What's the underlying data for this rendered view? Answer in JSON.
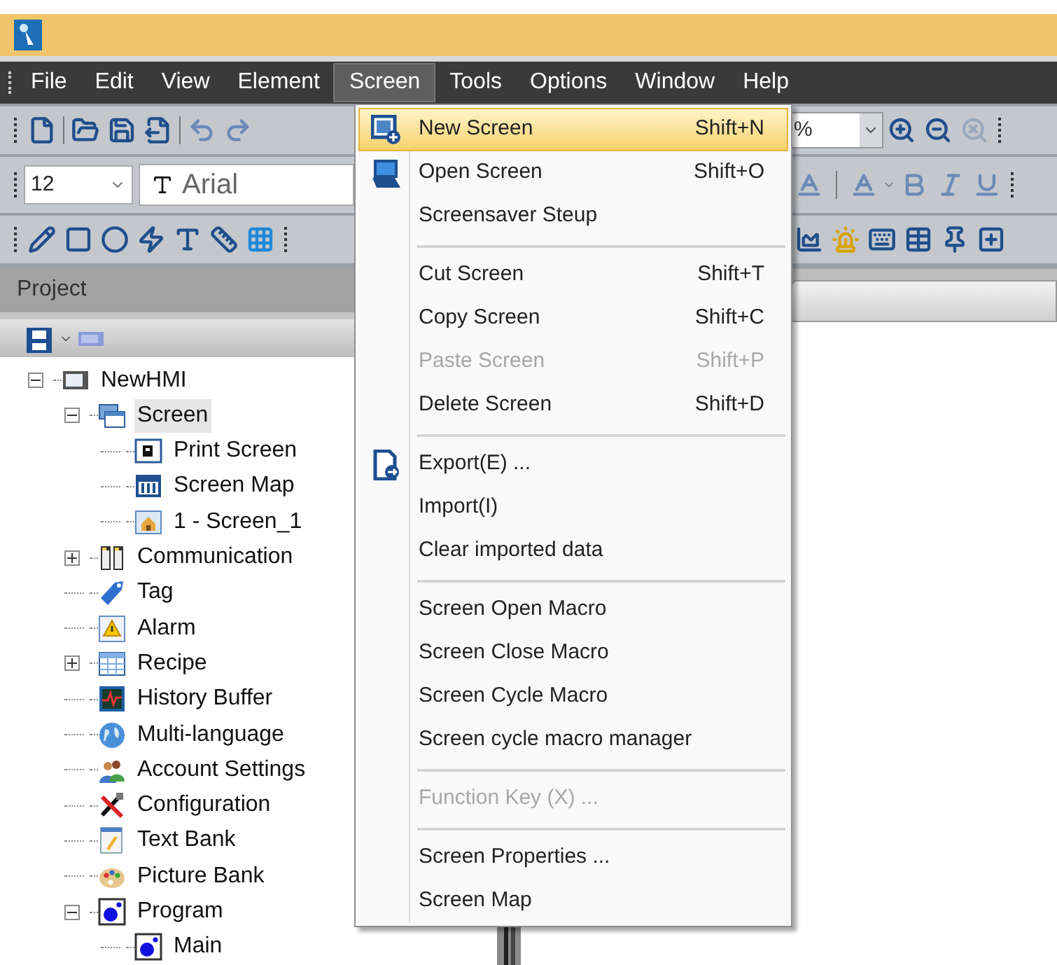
{
  "menubar": [
    {
      "label": "File",
      "selected": false
    },
    {
      "label": "Edit",
      "selected": false
    },
    {
      "label": "View",
      "selected": false
    },
    {
      "label": "Element",
      "selected": false
    },
    {
      "label": "Screen",
      "selected": true
    },
    {
      "label": "Tools",
      "selected": false
    },
    {
      "label": "Options",
      "selected": false
    },
    {
      "label": "Window",
      "selected": false
    },
    {
      "label": "Help",
      "selected": false
    }
  ],
  "toolbar": {
    "zoom_value": "%",
    "font_size": "12",
    "font_name": "Arial"
  },
  "project_panel": {
    "title": "Project"
  },
  "tree": [
    {
      "label": "NewHMI",
      "kind": "hmi",
      "expanded": true,
      "selected": false,
      "children": [
        {
          "label": "Screen",
          "kind": "screens",
          "expanded": true,
          "selected": true,
          "children": [
            {
              "label": "Print Screen",
              "kind": "print",
              "selected": false
            },
            {
              "label": "Screen Map",
              "kind": "map",
              "selected": false
            },
            {
              "label": "1 - Screen_1",
              "kind": "page",
              "selected": false
            }
          ]
        },
        {
          "label": "Communication",
          "kind": "communication",
          "expanded": false,
          "selected": false
        },
        {
          "label": "Tag",
          "kind": "tag",
          "selected": false
        },
        {
          "label": "Alarm",
          "kind": "alarm",
          "selected": false
        },
        {
          "label": "Recipe",
          "kind": "recipe",
          "expanded": false,
          "selected": false
        },
        {
          "label": "History Buffer",
          "kind": "history",
          "selected": false
        },
        {
          "label": "Multi-language",
          "kind": "language",
          "selected": false
        },
        {
          "label": "Account Settings",
          "kind": "account",
          "selected": false
        },
        {
          "label": "Configuration",
          "kind": "config",
          "selected": false
        },
        {
          "label": "Text Bank",
          "kind": "text",
          "selected": false
        },
        {
          "label": "Picture Bank",
          "kind": "picture",
          "selected": false
        },
        {
          "label": "Program",
          "kind": "program",
          "expanded": true,
          "selected": false,
          "children": [
            {
              "label": "Main",
              "kind": "program",
              "selected": false
            }
          ]
        }
      ]
    }
  ],
  "screen_menu": [
    [
      {
        "label": "New Screen",
        "shortcut": "Shift+N",
        "kind": "new",
        "selected": true,
        "disabled": false
      },
      {
        "label": "Open Screen",
        "shortcut": "Shift+O",
        "kind": "open",
        "selected": false,
        "disabled": false
      },
      {
        "label": "Screensaver Steup",
        "kind": "plain",
        "selected": false,
        "disabled": false
      }
    ],
    [
      {
        "label": "Cut Screen",
        "shortcut": "Shift+T",
        "kind": "plain",
        "selected": false,
        "disabled": false
      },
      {
        "label": "Copy Screen",
        "shortcut": "Shift+C",
        "kind": "plain",
        "selected": false,
        "disabled": false
      },
      {
        "label": "Paste Screen",
        "shortcut": "Shift+P",
        "kind": "plain",
        "selected": false,
        "disabled": true
      },
      {
        "label": "Delete Screen",
        "shortcut": "Shift+D",
        "kind": "plain",
        "selected": false,
        "disabled": false
      }
    ],
    [
      {
        "label": "Export(E) ...",
        "kind": "export",
        "selected": false,
        "disabled": false
      },
      {
        "label": "Import(I)",
        "kind": "plain",
        "selected": false,
        "disabled": false
      },
      {
        "label": "Clear imported data",
        "kind": "plain",
        "selected": false,
        "disabled": false
      }
    ],
    [
      {
        "label": "Screen Open Macro",
        "kind": "plain",
        "selected": false,
        "disabled": false
      },
      {
        "label": "Screen Close Macro",
        "kind": "plain",
        "selected": false,
        "disabled": false
      },
      {
        "label": "Screen Cycle Macro",
        "kind": "plain",
        "selected": false,
        "disabled": false
      },
      {
        "label": "Screen cycle macro manager",
        "kind": "plain",
        "selected": false,
        "disabled": false
      }
    ],
    [
      {
        "label": "Function Key (X) ...",
        "kind": "plain",
        "selected": false,
        "disabled": true
      }
    ],
    [
      {
        "label": "Screen Properties ...",
        "kind": "plain",
        "selected": false,
        "disabled": false
      },
      {
        "label": "Screen Map",
        "kind": "plain",
        "selected": false,
        "disabled": false
      }
    ]
  ]
}
